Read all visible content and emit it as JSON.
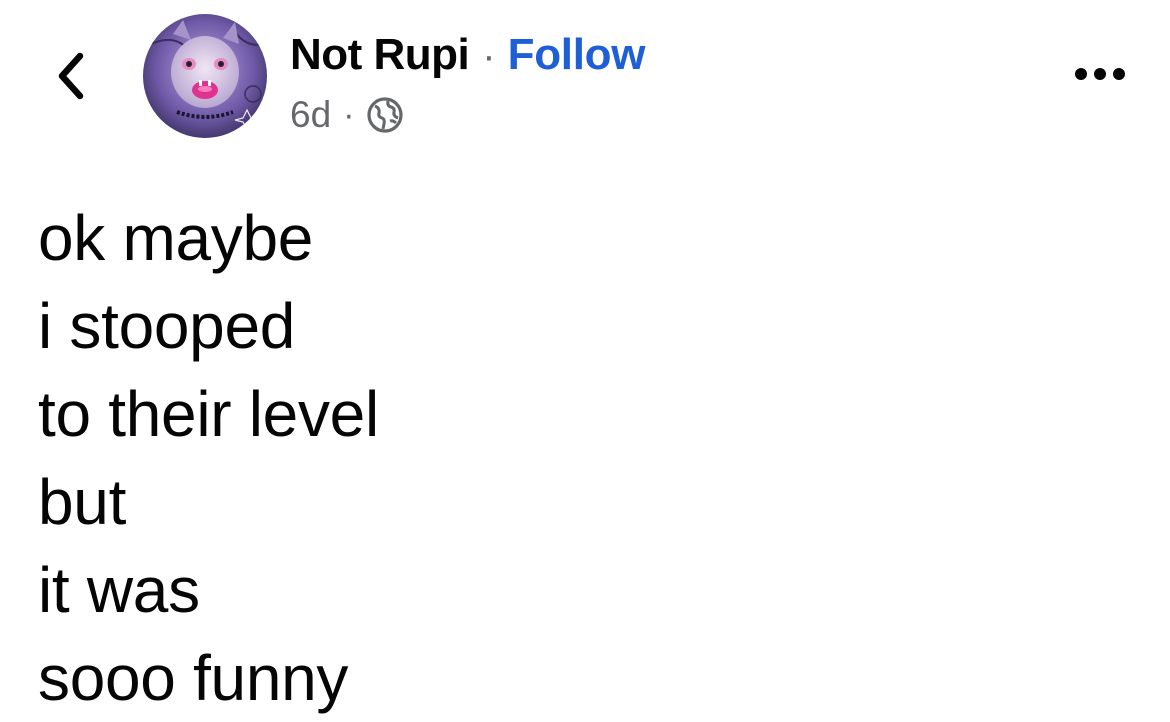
{
  "header": {
    "back_icon": "chevron-left-icon",
    "avatar_icon": "profile-avatar",
    "author_name": "Not Rupi",
    "name_separator": "·",
    "follow_label": "Follow",
    "time_label": "6d",
    "meta_separator": "·",
    "privacy_icon": "globe-icon",
    "more_icon": "more-horizontal-icon"
  },
  "post": {
    "lines": [
      "ok maybe",
      "i stooped",
      "to their level",
      "but",
      "it was",
      "sooo funny"
    ]
  },
  "colors": {
    "follow_link": "#1f5fd6",
    "secondary_text": "#65676b",
    "primary_text": "#050505"
  }
}
